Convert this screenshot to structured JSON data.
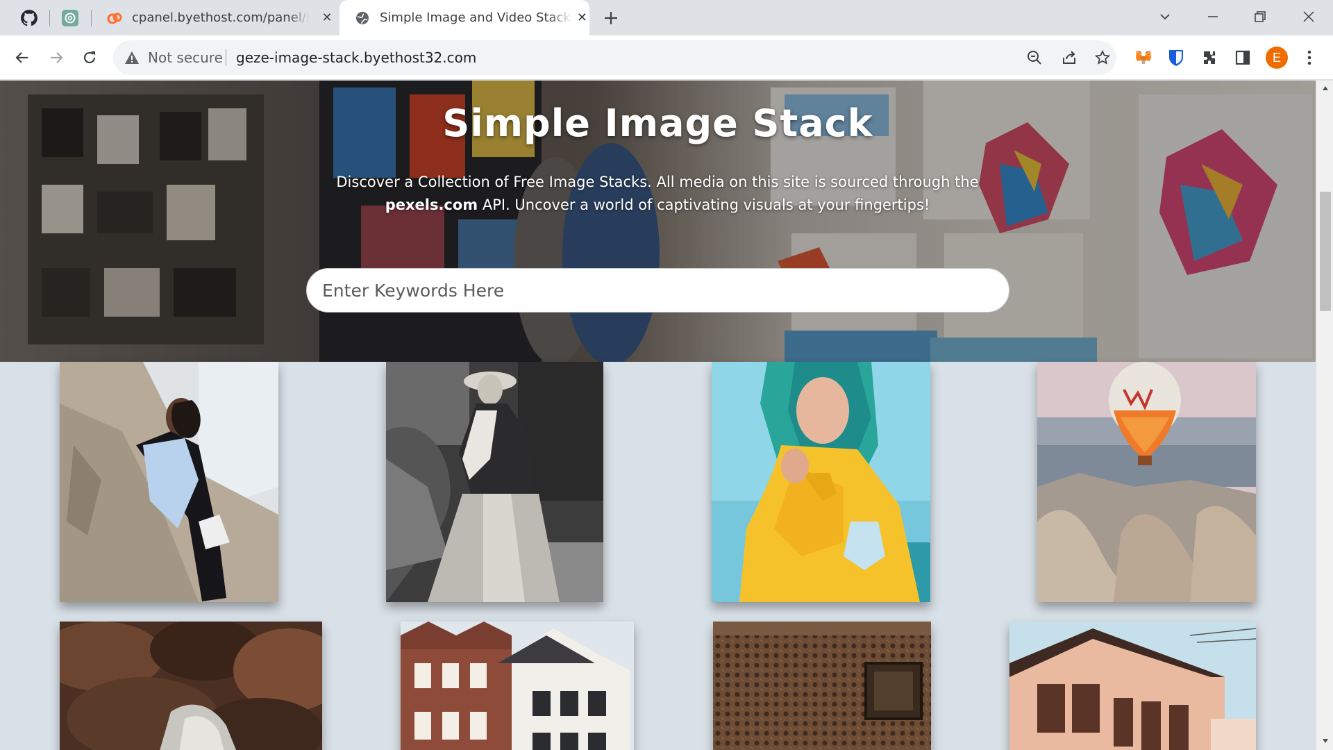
{
  "tabs": [
    {
      "title": "cpanel.byethost.com/panel/index.php",
      "close": "✕"
    },
    {
      "title": "Simple Image and Video Stack API",
      "close": "✕"
    }
  ],
  "newtab": "+",
  "address": {
    "security": "Not secure",
    "url": "geze-image-stack.byethost32.com"
  },
  "profile": {
    "initial": "E"
  },
  "hero": {
    "title": "Simple Image Stack",
    "desc_part1": "Discover a Collection of Free Image Stacks. All media on this site is sourced through the",
    "desc_bold": "pexels.com",
    "desc_part2": " API. Uncover a world of captivating visuals at your fingertips!",
    "search_placeholder": "Enter Keywords Here"
  },
  "icons": [
    "github-icon",
    "chatgpt-icon",
    "cpanel-favicon",
    "globe-icon",
    "chevron-down-icon",
    "minimize-icon",
    "restore-icon",
    "close-icon",
    "back-arrow-icon",
    "forward-arrow-icon",
    "reload-icon",
    "warning-icon",
    "zoom-icon",
    "share-icon",
    "star-icon",
    "metamask-icon",
    "bitwarden-icon",
    "extensions-icon",
    "sidepanel-icon",
    "menu-icon"
  ],
  "colors": {
    "page_bg": "#d9e1e8",
    "profile": "#ef6c00",
    "tab_bg": "#dee1e6"
  }
}
